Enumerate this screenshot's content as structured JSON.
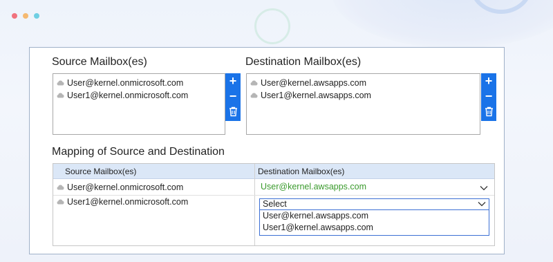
{
  "colors": {
    "accent": "#1a73e8",
    "green_text": "#3a9a2c"
  },
  "window_dots": [
    {
      "name": "close-dot",
      "color": "#f0727e"
    },
    {
      "name": "minimize-dot",
      "color": "#f5b971"
    },
    {
      "name": "maximize-dot",
      "color": "#6fcfe3"
    }
  ],
  "source": {
    "title": "Source Mailbox(es)",
    "items": [
      "User@kernel.onmicrosoft.com",
      "User1@kernel.onmicrosoft.com"
    ],
    "buttons": [
      {
        "name": "add-source-button",
        "icon": "plus-icon",
        "glyph": "+"
      },
      {
        "name": "remove-source-button",
        "icon": "minus-icon",
        "glyph": "−"
      },
      {
        "name": "delete-source-button",
        "icon": "trash-icon",
        "glyph": ""
      }
    ]
  },
  "destination": {
    "title": "Destination Mailbox(es)",
    "items": [
      "User@kernel.awsapps.com",
      "User1@kernel.awsapps.com"
    ],
    "buttons": [
      {
        "name": "add-destination-button",
        "icon": "plus-icon",
        "glyph": "+"
      },
      {
        "name": "remove-destination-button",
        "icon": "minus-icon",
        "glyph": "−"
      },
      {
        "name": "delete-destination-button",
        "icon": "trash-icon",
        "glyph": ""
      }
    ]
  },
  "mapping": {
    "title": "Mapping of Source and Destination",
    "col_source": "Source Mailbox(es)",
    "col_destination": "Destination Mailbox(es)",
    "rows": [
      {
        "source": "User@kernel.onmicrosoft.com",
        "destination": "User@kernel.awsapps.com"
      },
      {
        "source": "User1@kernel.onmicrosoft.com",
        "destination": "Select"
      }
    ],
    "dropdown_options": [
      "User@kernel.awsapps.com",
      "User1@kernel.awsapps.com"
    ]
  }
}
